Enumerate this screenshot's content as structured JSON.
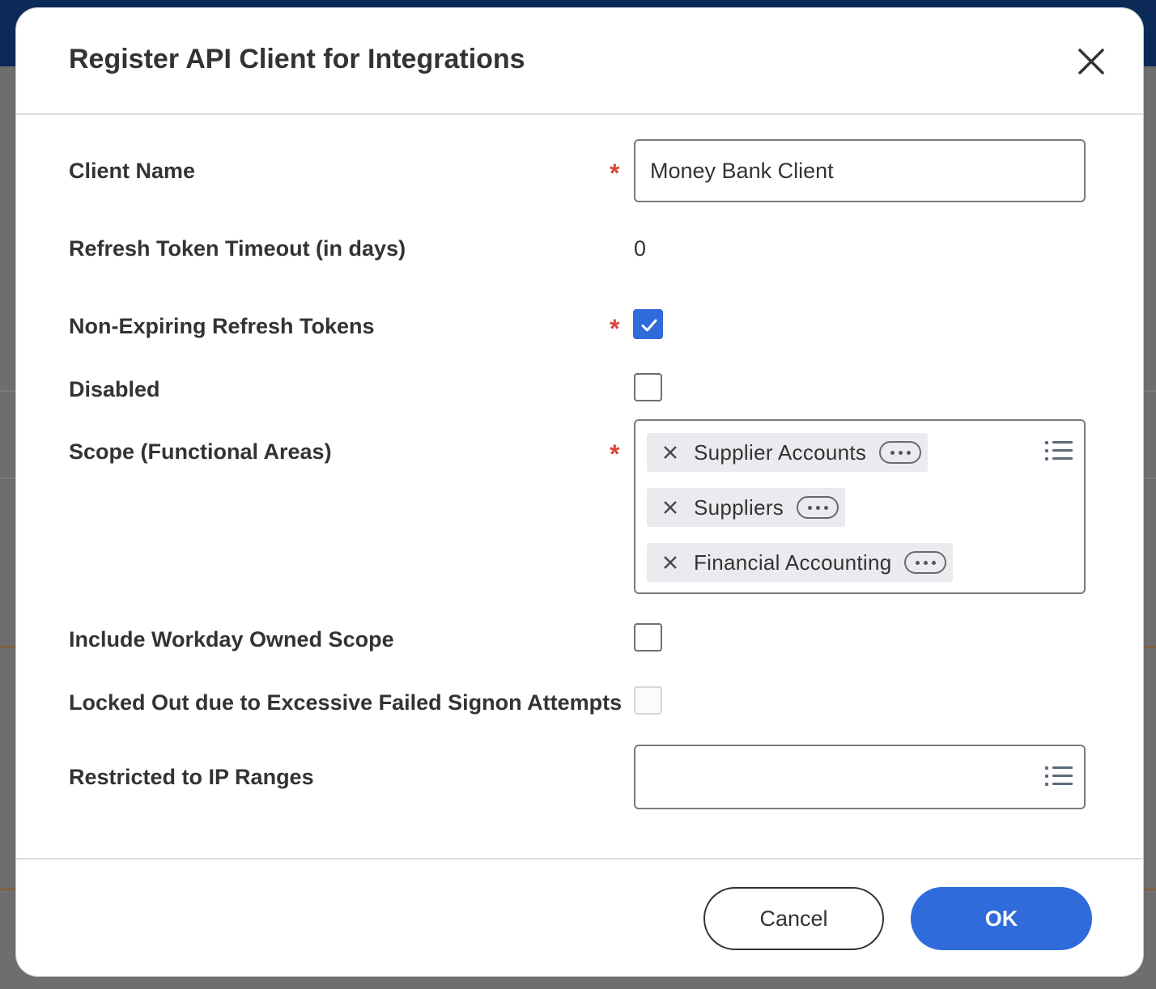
{
  "modal": {
    "title": "Register API Client for Integrations"
  },
  "form": {
    "client_name": {
      "label": "Client Name",
      "required_marker": "*",
      "value": "Money Bank Client"
    },
    "refresh_token_timeout": {
      "label": "Refresh Token Timeout (in days)",
      "value": "0"
    },
    "non_expiring_refresh_tokens": {
      "label": "Non-Expiring Refresh Tokens",
      "required_marker": "*",
      "checked": true
    },
    "disabled": {
      "label": "Disabled",
      "checked": false
    },
    "scope": {
      "label": "Scope (Functional Areas)",
      "required_marker": "*",
      "items": [
        {
          "label": "Supplier Accounts"
        },
        {
          "label": "Suppliers"
        },
        {
          "label": "Financial Accounting"
        }
      ]
    },
    "include_workday_owned_scope": {
      "label": "Include Workday Owned Scope",
      "checked": false
    },
    "locked_out": {
      "label": "Locked Out due to Excessive Failed Signon Attempts",
      "checked": false,
      "enabled": false
    },
    "restricted_ip_ranges": {
      "label": "Restricted to IP Ranges",
      "value": ""
    }
  },
  "footer": {
    "cancel_label": "Cancel",
    "ok_label": "OK"
  },
  "colors": {
    "accent": "#2f6bdb",
    "required": "#d9473b",
    "text": "#333333"
  },
  "icons": {
    "close": "close-icon",
    "checkmark": "checkmark-icon",
    "remove": "remove-x-icon",
    "more": "ellipsis-icon",
    "list": "list-icon"
  }
}
